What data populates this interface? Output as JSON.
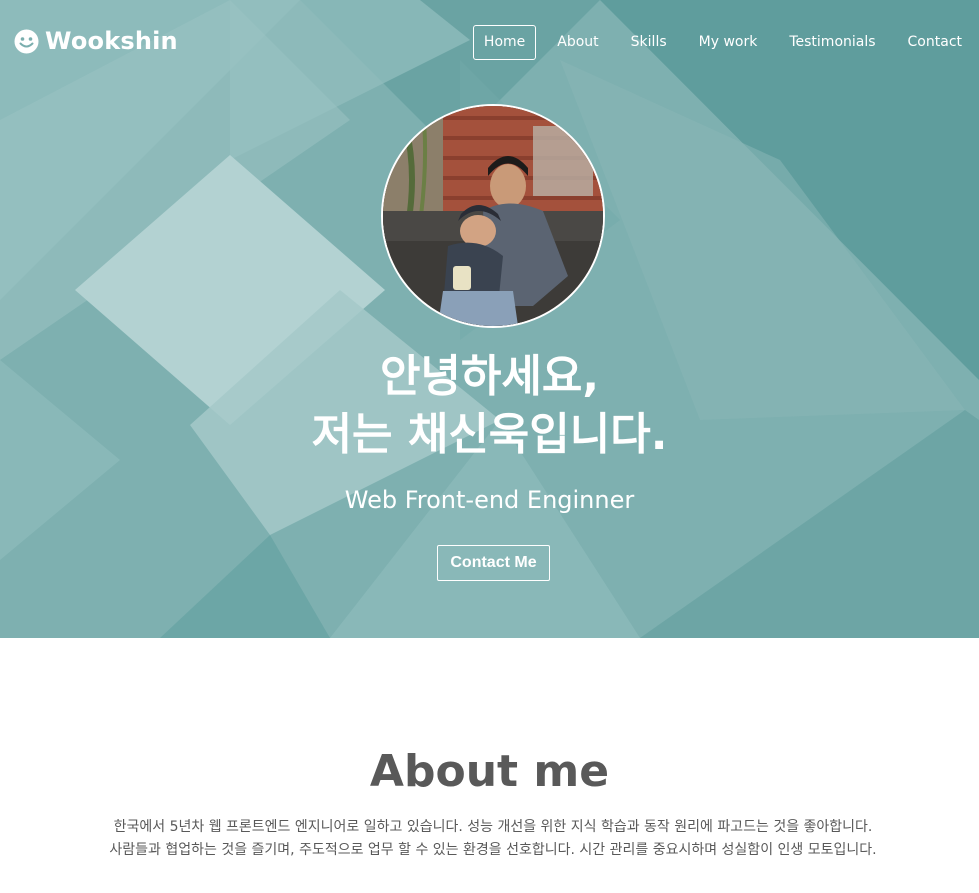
{
  "brand": {
    "name": "Wookshin",
    "icon": "smiley-icon"
  },
  "nav": {
    "items": [
      {
        "label": "Home",
        "active": true
      },
      {
        "label": "About",
        "active": false
      },
      {
        "label": "Skills",
        "active": false
      },
      {
        "label": "My work",
        "active": false
      },
      {
        "label": "Testimonials",
        "active": false
      },
      {
        "label": "Contact",
        "active": false
      }
    ]
  },
  "hero": {
    "greeting_line1": "안녕하세요,",
    "greeting_line2": "저는 채신욱입니다.",
    "subtitle": "Web Front-end Enginner",
    "contact_button": "Contact Me",
    "background_color": "#7aaeae"
  },
  "about": {
    "title": "About me",
    "line1": "한국에서 5년차 웹 프론트엔드 엔지니어로 일하고 있습니다. 성능 개선을 위한 지식 학습과 동작 원리에 파고드는 것을 좋아합니다.",
    "line2": "사람들과 협업하는 것을 즐기며, 주도적으로 업무 할 수 있는 환경을 선호합니다. 시간 관리를 중요시하며 성실함이 인생 모토입니다."
  },
  "colors": {
    "hero_teal": "#7aaeae",
    "text_dark": "#595959",
    "white": "#ffffff"
  }
}
